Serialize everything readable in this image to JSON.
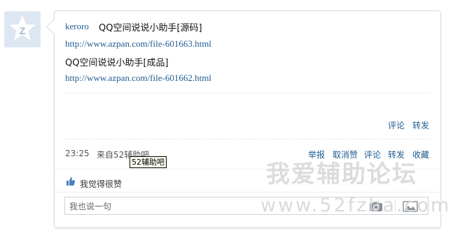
{
  "post": {
    "author": "keroro",
    "line1": "QQ空间说说小助手[源码]",
    "link1": "http://www.azpan.com/file-601663.html",
    "line2": "QQ空间说说小助手[成品]",
    "link2": "http://www.azpan.com/file-601662.html"
  },
  "inner_actions": {
    "comment": "评论",
    "forward": "转发"
  },
  "meta": {
    "time": "23:25",
    "source": "来自52辅助吧"
  },
  "tooltip": "52辅助吧",
  "actions": {
    "report": "举报",
    "unlike": "取消赞",
    "comment": "评论",
    "forward": "转发",
    "favorite": "收藏"
  },
  "likes": {
    "text": "我觉得很赞"
  },
  "comment_box": {
    "placeholder": "我也说一句"
  },
  "watermark": {
    "line1": "我爱辅助论坛",
    "line2": "www.52fzba.com"
  },
  "colors": {
    "link": "#1f5c91",
    "avatar_bg": "#dde7f2",
    "card_border": "#d9dde2"
  },
  "icons": {
    "avatar": "qzone-star-icon",
    "like": "thumbs-up-icon",
    "camera": "camera-icon",
    "image": "image-icon"
  }
}
